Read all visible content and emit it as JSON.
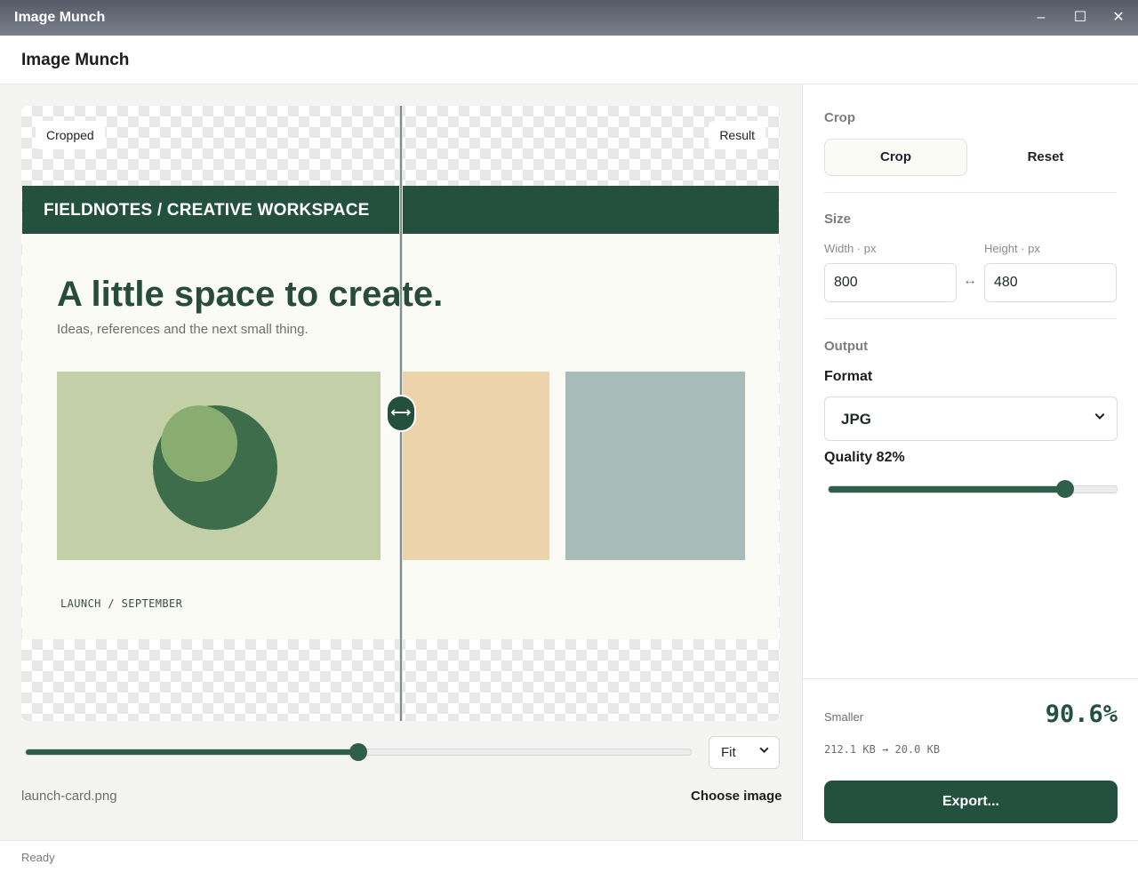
{
  "window": {
    "title": "Image Munch",
    "minimize_glyph": "‒",
    "maximize_glyph": "☐",
    "close_glyph": "✕"
  },
  "app": {
    "name": "Image Munch"
  },
  "preview": {
    "left_tag": "Cropped",
    "right_tag": "Result",
    "split_position": 0.5,
    "card": {
      "band_text": "FIELDNOTES / CREATIVE WORKSPACE",
      "headline": "A little space to create.",
      "subline": "Ideas, references and the next small thing.",
      "footer": "LAUNCH / SEPTEMBER"
    }
  },
  "controls": {
    "zoom_level": 0.5,
    "fit_value": "Fit",
    "filename": "launch-card.png",
    "choose_label": "Choose image"
  },
  "panel": {
    "crop": {
      "section": "Crop",
      "crop_label": "Crop",
      "reset_label": "Reset"
    },
    "size": {
      "section": "Size",
      "width_label": "Width · px",
      "height_label": "Height · px",
      "width_value": "800",
      "height_value": "480",
      "link_glyph": "↔"
    },
    "output": {
      "section": "Output",
      "format_label": "Format",
      "format_value": "JPG",
      "quality_label": "Quality 82%",
      "quality_value": 0.82
    },
    "summary": {
      "smaller_label": "Smaller",
      "percent": "90.6%",
      "sizes": "212.1 KB → 20.0 KB",
      "export_label": "Export..."
    }
  },
  "status": {
    "text": "Ready"
  },
  "colors": {
    "accent": "#24503f",
    "tile_green": "#c2cfa7",
    "tile_peach": "#edd3aa",
    "tile_blue": "#a7bcb8"
  }
}
